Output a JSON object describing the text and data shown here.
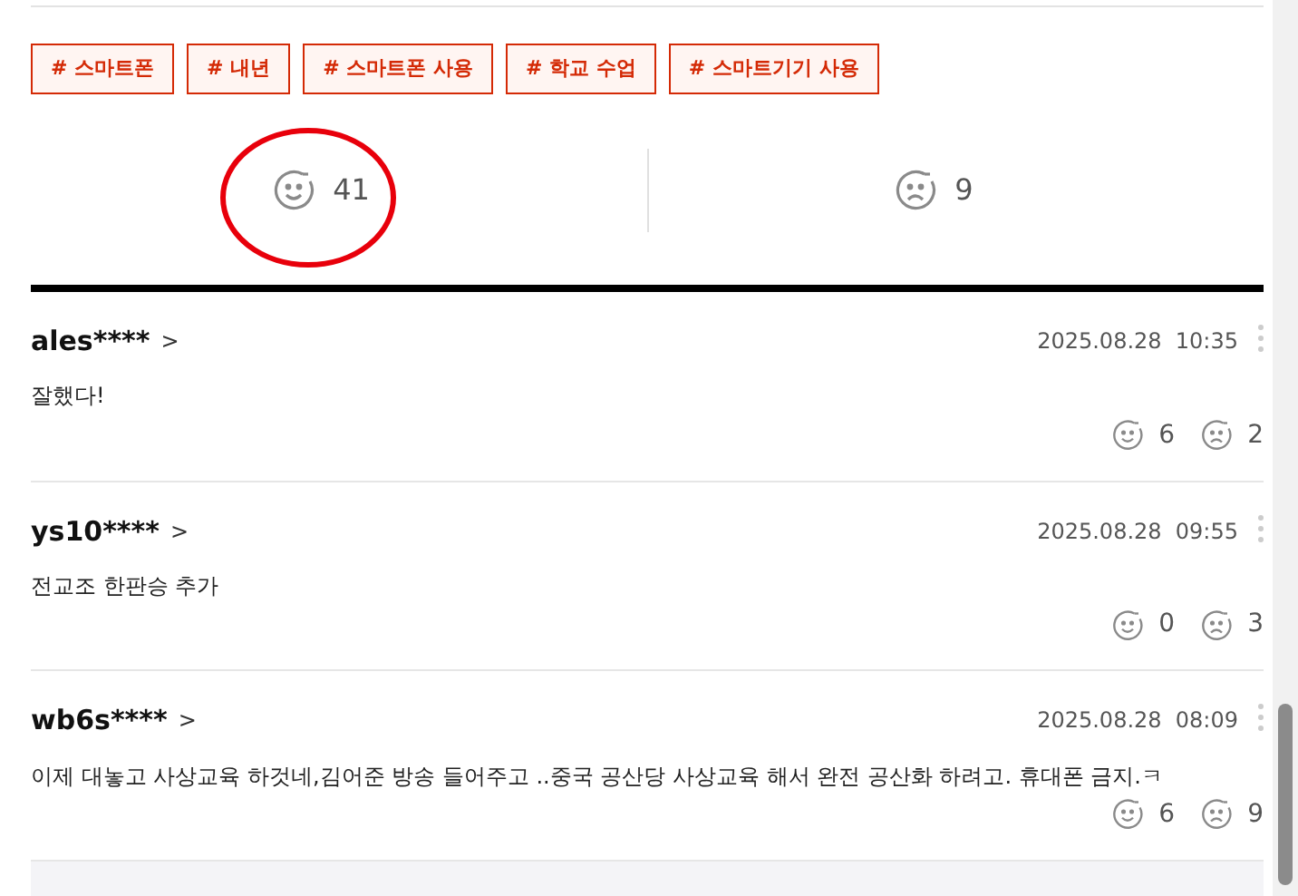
{
  "tags": [
    "# 스마트폰",
    "# 내년",
    "# 스마트폰 사용",
    "# 학교 수업",
    "# 스마트기기 사용"
  ],
  "reactions": {
    "like": "41",
    "dislike": "9",
    "highlighted": true
  },
  "comments": [
    {
      "user": "ales****",
      "arrow": ">",
      "time": "2025.08.28  10:35",
      "text": "잘했다!",
      "likes": "6",
      "dislikes": "2"
    },
    {
      "user": "ys10****",
      "arrow": ">",
      "time": "2025.08.28  09:55",
      "text": "전교조 한판승 추가",
      "likes": "0",
      "dislikes": "3"
    },
    {
      "user": "wb6s****",
      "arrow": ">",
      "time": "2025.08.28  08:09",
      "text": "이제 대놓고 사상교육 하것네,김어준 방송 들어주고 ..중국 공산당 사상교육 해서 완전 공산화 하려고. 휴대폰 금지.ㅋ",
      "likes": "6",
      "dislikes": "9"
    }
  ]
}
